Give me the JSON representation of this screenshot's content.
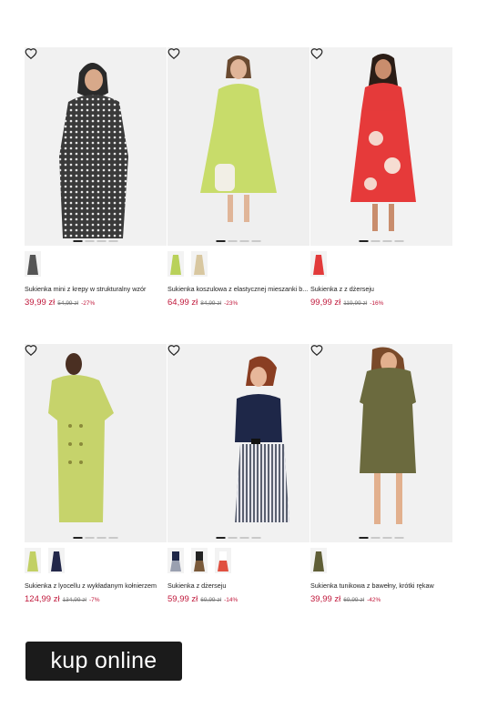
{
  "products": [
    {
      "name": "Sukienka mini z krepy w strukturalny wzór",
      "price": "39,99 zł",
      "old_price": "54,99 zł",
      "discount": "-27%"
    },
    {
      "name": "Sukienka koszulowa z elastycznej mieszanki b...",
      "price": "64,99 zł",
      "old_price": "84,99 zł",
      "discount": "-23%"
    },
    {
      "name": "Sukienka z z dżerseju",
      "price": "99,99 zł",
      "old_price": "119,99 zł",
      "discount": "-16%"
    },
    {
      "name": "Sukienka z lyocellu z wykładanym kołnierzem",
      "price": "124,99 zł",
      "old_price": "134,99 zł",
      "discount": "-7%"
    },
    {
      "name": "Sukienka z dżerseju",
      "price": "59,99 zł",
      "old_price": "69,99 zł",
      "discount": "-14%"
    },
    {
      "name": "Sukienka tunikowa z bawełny, krótki rękaw",
      "price": "39,99 zł",
      "old_price": "69,99 zł",
      "discount": "-42%"
    }
  ],
  "cta": {
    "label": "kup online"
  },
  "colors": {
    "price": "#c0183b",
    "cta_bg": "#1b1b1b"
  }
}
